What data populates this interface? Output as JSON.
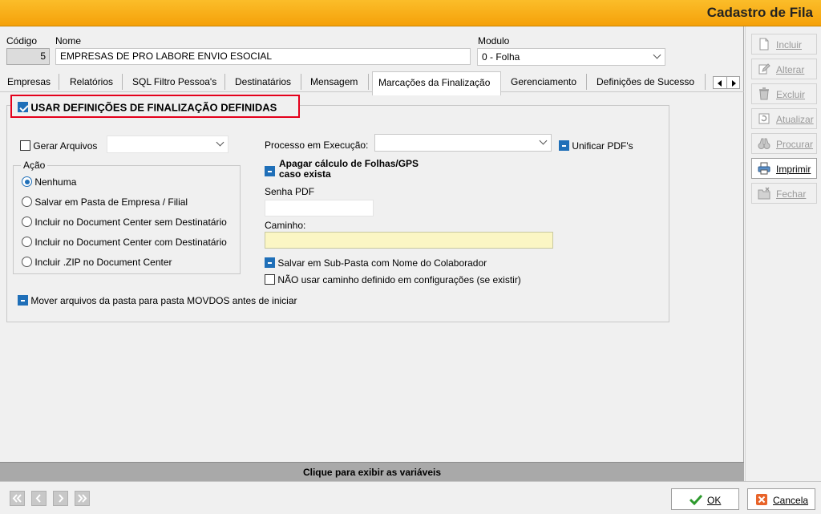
{
  "window": {
    "title": "Cadastro de Fila"
  },
  "header": {
    "codigo_label": "Código",
    "codigo_value": "5",
    "nome_label": "Nome",
    "nome_value": "EMPRESAS DE PRO LABORE ENVIO ESOCIAL",
    "modulo_label": "Modulo",
    "modulo_value": "0 - Folha"
  },
  "tabs": [
    {
      "label": "Empresas"
    },
    {
      "label": "Relatórios"
    },
    {
      "label": "SQL Filtro Pessoa's"
    },
    {
      "label": "Destinatários"
    },
    {
      "label": "Mensagem"
    },
    {
      "label": "Marcações da Finalização"
    },
    {
      "label": "Gerenciamento"
    },
    {
      "label": "Definições de Sucesso"
    }
  ],
  "tab_scroll": {
    "left_icon": "arrow-left-icon",
    "right_icon": "arrow-right-icon"
  },
  "content": {
    "usar_definicoes": {
      "label": "USAR DEFINIÇÕES DE FINALIZAÇÃO DEFINIDAS",
      "checked": true
    },
    "gerar_arquivos": {
      "label": "Gerar Arquivos",
      "checked": false,
      "value": ""
    },
    "acao": {
      "legend": "Ação",
      "options": [
        {
          "label": "Nenhuma",
          "selected": true
        },
        {
          "label": "Salvar em Pasta de Empresa / Filial",
          "selected": false
        },
        {
          "label": "Incluir no Document Center sem Destinatário",
          "selected": false
        },
        {
          "label": "Incluir no Document Center com Destinatário",
          "selected": false
        },
        {
          "label": "Incluir .ZIP no Document Center",
          "selected": false
        }
      ]
    },
    "processo_label": "Processo em Execução:",
    "processo_value": "",
    "unificar_pdfs": {
      "label": "Unificar PDF's",
      "state": "indeterminate"
    },
    "apagar_calculo": {
      "label_line1": "Apagar cálculo de Folhas/GPS",
      "label_line2": "caso exista",
      "state": "indeterminate"
    },
    "senha_pdf_label": "Senha PDF",
    "senha_pdf_value": "",
    "caminho_label": "Caminho:",
    "caminho_value": "",
    "salvar_subpasta": {
      "label": "Salvar em  Sub-Pasta com Nome do  Colaborador",
      "state": "indeterminate"
    },
    "nao_usar_caminho": {
      "label": "NÃO usar caminho definido em configurações (se existir)",
      "checked": false
    },
    "mover_arquivos": {
      "label": "Mover arquivos da pasta para pasta MOVDOS antes de iniciar",
      "state": "indeterminate"
    }
  },
  "bottom_bar": {
    "label": "Clique para exibir as variáveis"
  },
  "sidebar": {
    "buttons": [
      {
        "label": "Incluir",
        "icon": "document-icon",
        "enabled": false
      },
      {
        "label": "Alterar",
        "icon": "edit-icon",
        "enabled": false
      },
      {
        "label": "Excluir",
        "icon": "trash-icon",
        "enabled": false
      },
      {
        "label": "Atualizar",
        "icon": "refresh-icon",
        "enabled": false
      },
      {
        "label": "Procurar",
        "icon": "binoculars-icon",
        "enabled": false
      },
      {
        "label": "Imprimir",
        "icon": "printer-icon",
        "enabled": true
      },
      {
        "label": "Fechar",
        "icon": "folder-close-icon",
        "enabled": false
      }
    ]
  },
  "footer": {
    "nav": [
      "first-record-icon",
      "previous-record-icon",
      "next-record-icon",
      "last-record-icon"
    ],
    "ok_label": "OK",
    "cancel_label": "Cancela"
  },
  "colors": {
    "title_bar": "#f5a10a",
    "highlight_red": "#e4001b",
    "check_blue": "#1f6fb8",
    "caminho_field": "#fbf6c4"
  }
}
